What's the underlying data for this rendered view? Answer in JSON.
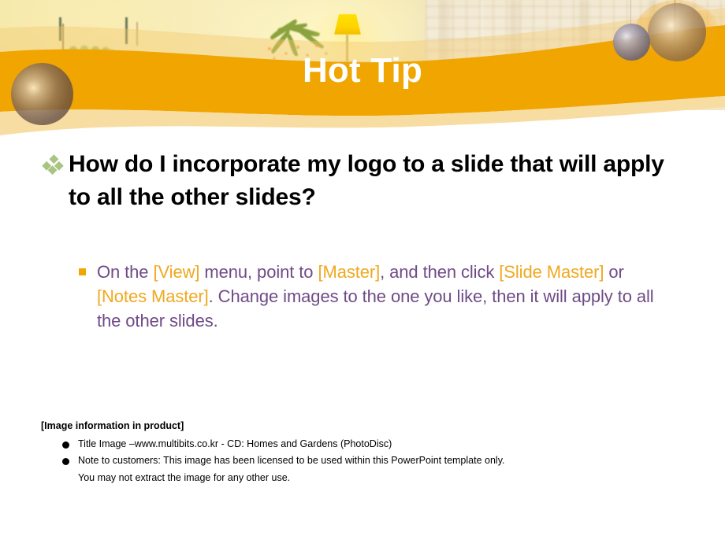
{
  "slide": {
    "title": "Hot Tip",
    "heading": "How do I incorporate my logo to a slide that will apply to all the other slides?",
    "body": {
      "seg1": "On the ",
      "kw1": "[View]",
      "seg2": " menu, point to ",
      "kw2": "[Master]",
      "seg3": ", and then click ",
      "kw3": "[Slide Master]",
      "seg4": " or ",
      "kw4": "[Notes Master]",
      "seg5": ". Change images to the one you like, then it will apply to all the other slides."
    },
    "footnote": {
      "title": "[Image information in product]",
      "items": [
        "Title Image –www.multibits.co.kr - CD: Homes and Gardens (PhotoDisc)",
        "Note to customers: This image has been licensed to be used within this PowerPoint template only."
      ],
      "continuation": "You may not   extract the image for any other use."
    }
  },
  "icons": {
    "heading_bullet": "diamond-cluster-bullet",
    "body_bullet": "square-bullet",
    "footnote_bullet": "filled-circle-bullet"
  },
  "colors": {
    "banner_orange": "#f0a500",
    "banner_peach": "#f8dda3",
    "title_text": "#ffffff",
    "heading_text": "#000000",
    "body_text": "#6f4b86",
    "body_highlight": "#f0a81f",
    "diamond_bullet": "#a8c581",
    "square_bullet": "#f0a500",
    "background": "#ffffff"
  }
}
